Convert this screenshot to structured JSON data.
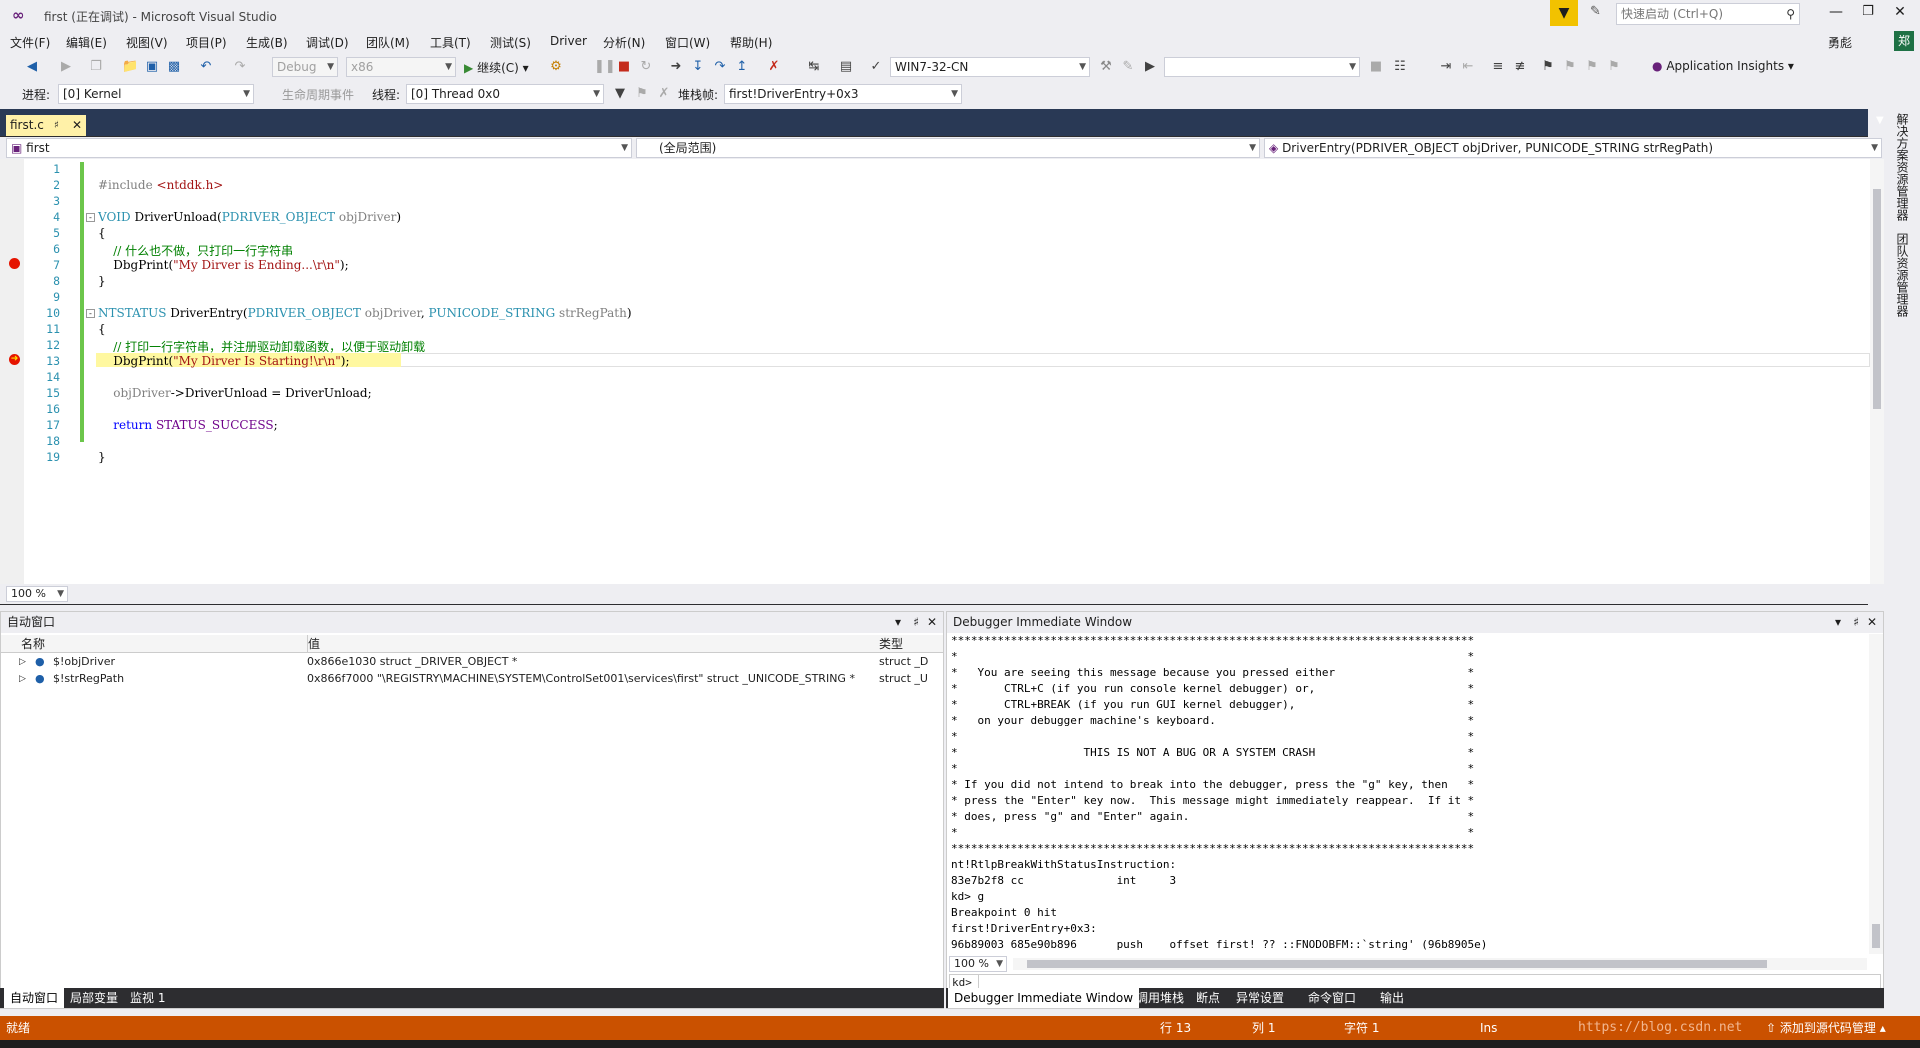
{
  "window": {
    "title": "first (正在调试) - Microsoft Visual Studio",
    "quick_launch_placeholder": "快速启动 (Ctrl+Q)",
    "user": "勇彪",
    "account_badge": "郑"
  },
  "menu": [
    "文件(F)",
    "编辑(E)",
    "视图(V)",
    "项目(P)",
    "生成(B)",
    "调试(D)",
    "团队(M)",
    "工具(T)",
    "测试(S)",
    "Driver",
    "分析(N)",
    "窗口(W)",
    "帮助(H)"
  ],
  "toolbar": {
    "config": "Debug",
    "platform": "x86",
    "continue": "继续(C)",
    "target": "WIN7-32-CN",
    "app_insights": "Application Insights"
  },
  "debugbar": {
    "process_label": "进程:",
    "process": "[0] Kernel",
    "lifecycle_label": "生命周期事件",
    "thread_label": "线程:",
    "thread": "[0] Thread 0x0",
    "stack_label": "堆栈帧:",
    "stack": "first!DriverEntry+0x3"
  },
  "editor": {
    "tab": "first.c",
    "scope_project": "first",
    "scope_global": "(全局范围)",
    "scope_function": "DriverEntry(PDRIVER_OBJECT objDriver, PUNICODE_STRING strRegPath)",
    "zoom": "100 %",
    "lines": [
      "1",
      "2",
      "3",
      "4",
      "5",
      "6",
      "7",
      "8",
      "9",
      "10",
      "11",
      "12",
      "13",
      "14",
      "15",
      "16",
      "17",
      "18",
      "19"
    ]
  },
  "autos": {
    "title": "自动窗口",
    "col_name": "名称",
    "col_value": "值",
    "col_type": "类型",
    "rows": [
      {
        "name": "$!objDriver",
        "value": "0x866e1030 struct _DRIVER_OBJECT *",
        "type": "struct _D"
      },
      {
        "name": "$!strRegPath",
        "value": "0x866f7000 \"\\REGISTRY\\MACHINE\\SYSTEM\\ControlSet001\\services\\first\" struct _UNICODE_STRING *",
        "type": "struct _U"
      }
    ],
    "tabs": [
      "自动窗口",
      "局部变量",
      "监视 1"
    ]
  },
  "immediate": {
    "title": "Debugger Immediate Window",
    "zoom": "100 %",
    "prompt": "kd>",
    "lines": [
      "*******************************************************************************",
      "*                                                                             *",
      "*   You are seeing this message because you pressed either                    *",
      "*       CTRL+C (if you run console kernel debugger) or,                       *",
      "*       CTRL+BREAK (if you run GUI kernel debugger),                          *",
      "*   on your debugger machine's keyboard.                                      *",
      "*                                                                             *",
      "*                   THIS IS NOT A BUG OR A SYSTEM CRASH                       *",
      "*                                                                             *",
      "* If you did not intend to break into the debugger, press the \"g\" key, then   *",
      "* press the \"Enter\" key now.  This message might immediately reappear.  If it *",
      "* does, press \"g\" and \"Enter\" again.                                          *",
      "*                                                                             *",
      "*******************************************************************************",
      "nt!RtlpBreakWithStatusInstruction:",
      "83e7b2f8 cc              int     3",
      "kd> g",
      "Breakpoint 0 hit",
      "first!DriverEntry+0x3:",
      "96b89003 685e90b896      push    offset first! ?? ::FNODOBFM::`string' (96b8905e)"
    ],
    "tabs": [
      "Debugger Immediate Window",
      "调用堆栈",
      "断点",
      "异常设置",
      "命令窗口",
      "输出"
    ]
  },
  "status": {
    "ready": "就绪",
    "line": "行 13",
    "col": "列 1",
    "char": "字符 1",
    "mode": "Ins",
    "watermark": "https://blog.csdn.net",
    "source_control": "添加到源代码管理"
  },
  "rail": [
    "解决方案资源管理器",
    "团队资源管理器"
  ]
}
